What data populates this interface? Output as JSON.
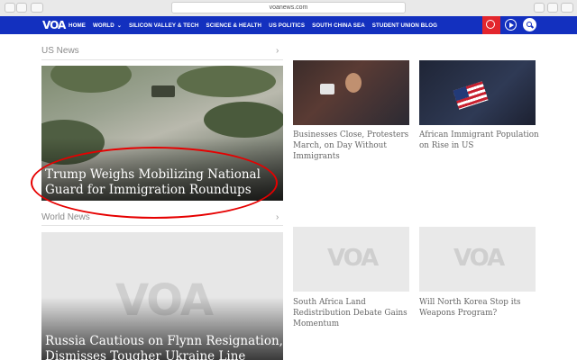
{
  "browser": {
    "url": "voanews.com"
  },
  "nav": {
    "logo": "VOA",
    "items": [
      "HOME",
      "WORLD",
      "SILICON VALLEY & TECH",
      "SCIENCE & HEALTH",
      "US POLITICS",
      "SOUTH CHINA SEA",
      "STUDENT UNION BLOG"
    ],
    "accent_color": "#1330bf",
    "radio_color": "#e3262d"
  },
  "sections": {
    "us_news": {
      "title": "US News",
      "arrow": "›",
      "feature": {
        "headline_line1": "Trump Weighs Mobilizing National",
        "headline_line2": "Guard for Immigration Roundups"
      },
      "stories": [
        {
          "title": "Businesses Close, Protesters March, on Day Without Immigrants"
        },
        {
          "title": "African Immigrant Population on Rise in US"
        }
      ]
    },
    "world_news": {
      "title": "World News",
      "arrow": "›",
      "feature": {
        "placeholder_logo": "VOA",
        "headline_line1": "Russia Cautious on Flynn Resignation,",
        "headline_line2": "Dismisses Tougher Ukraine Line"
      },
      "stories": [
        {
          "title": "South Africa Land Redistribution Debate Gains Momentum",
          "placeholder_logo": "VOA"
        },
        {
          "title": "Will North Korea Stop its Weapons Program?",
          "placeholder_logo": "VOA"
        }
      ]
    }
  }
}
